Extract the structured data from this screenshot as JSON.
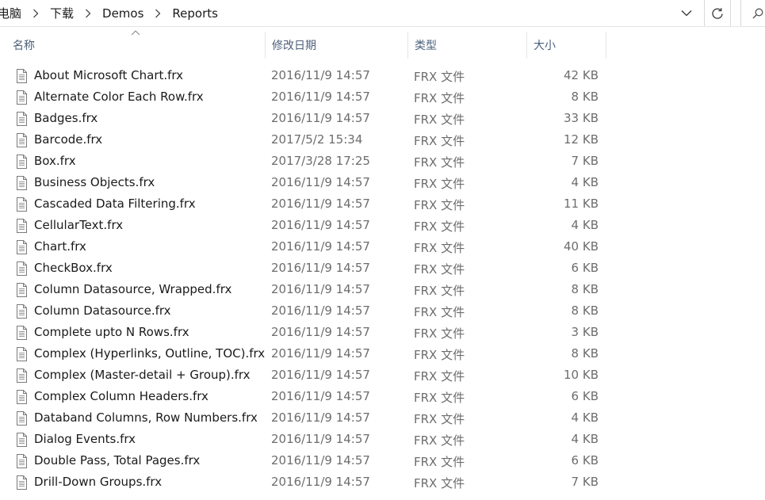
{
  "breadcrumb": {
    "items": [
      "电脑",
      "下载",
      "Demos",
      "Reports"
    ]
  },
  "columns": {
    "name": "名称",
    "modified": "修改日期",
    "type": "类型",
    "size": "大小"
  },
  "colors": {
    "header_text": "#4c607a",
    "secondary_text": "#6d6d6d",
    "icon_stroke": "#7a7a7a"
  },
  "files": [
    {
      "name": "About Microsoft Chart.frx",
      "modified": "2016/11/9 14:57",
      "type": "FRX 文件",
      "size": "42 KB"
    },
    {
      "name": "Alternate Color Each Row.frx",
      "modified": "2016/11/9 14:57",
      "type": "FRX 文件",
      "size": "8 KB"
    },
    {
      "name": "Badges.frx",
      "modified": "2016/11/9 14:57",
      "type": "FRX 文件",
      "size": "33 KB"
    },
    {
      "name": "Barcode.frx",
      "modified": "2017/5/2 15:34",
      "type": "FRX 文件",
      "size": "12 KB"
    },
    {
      "name": "Box.frx",
      "modified": "2017/3/28 17:25",
      "type": "FRX 文件",
      "size": "7 KB"
    },
    {
      "name": "Business Objects.frx",
      "modified": "2016/11/9 14:57",
      "type": "FRX 文件",
      "size": "4 KB"
    },
    {
      "name": "Cascaded Data Filtering.frx",
      "modified": "2016/11/9 14:57",
      "type": "FRX 文件",
      "size": "11 KB"
    },
    {
      "name": "CellularText.frx",
      "modified": "2016/11/9 14:57",
      "type": "FRX 文件",
      "size": "4 KB"
    },
    {
      "name": "Chart.frx",
      "modified": "2016/11/9 14:57",
      "type": "FRX 文件",
      "size": "40 KB"
    },
    {
      "name": "CheckBox.frx",
      "modified": "2016/11/9 14:57",
      "type": "FRX 文件",
      "size": "6 KB"
    },
    {
      "name": "Column Datasource, Wrapped.frx",
      "modified": "2016/11/9 14:57",
      "type": "FRX 文件",
      "size": "8 KB"
    },
    {
      "name": "Column Datasource.frx",
      "modified": "2016/11/9 14:57",
      "type": "FRX 文件",
      "size": "8 KB"
    },
    {
      "name": "Complete upto N Rows.frx",
      "modified": "2016/11/9 14:57",
      "type": "FRX 文件",
      "size": "3 KB"
    },
    {
      "name": "Complex (Hyperlinks, Outline, TOC).frx",
      "modified": "2016/11/9 14:57",
      "type": "FRX 文件",
      "size": "8 KB"
    },
    {
      "name": "Complex (Master-detail + Group).frx",
      "modified": "2016/11/9 14:57",
      "type": "FRX 文件",
      "size": "10 KB"
    },
    {
      "name": "Complex Column Headers.frx",
      "modified": "2016/11/9 14:57",
      "type": "FRX 文件",
      "size": "6 KB"
    },
    {
      "name": "Databand Columns, Row Numbers.frx",
      "modified": "2016/11/9 14:57",
      "type": "FRX 文件",
      "size": "4 KB"
    },
    {
      "name": "Dialog Events.frx",
      "modified": "2016/11/9 14:57",
      "type": "FRX 文件",
      "size": "4 KB"
    },
    {
      "name": "Double Pass, Total Pages.frx",
      "modified": "2016/11/9 14:57",
      "type": "FRX 文件",
      "size": "6 KB"
    },
    {
      "name": "Drill-Down Groups.frx",
      "modified": "2016/11/9 14:57",
      "type": "FRX 文件",
      "size": "7 KB"
    }
  ]
}
